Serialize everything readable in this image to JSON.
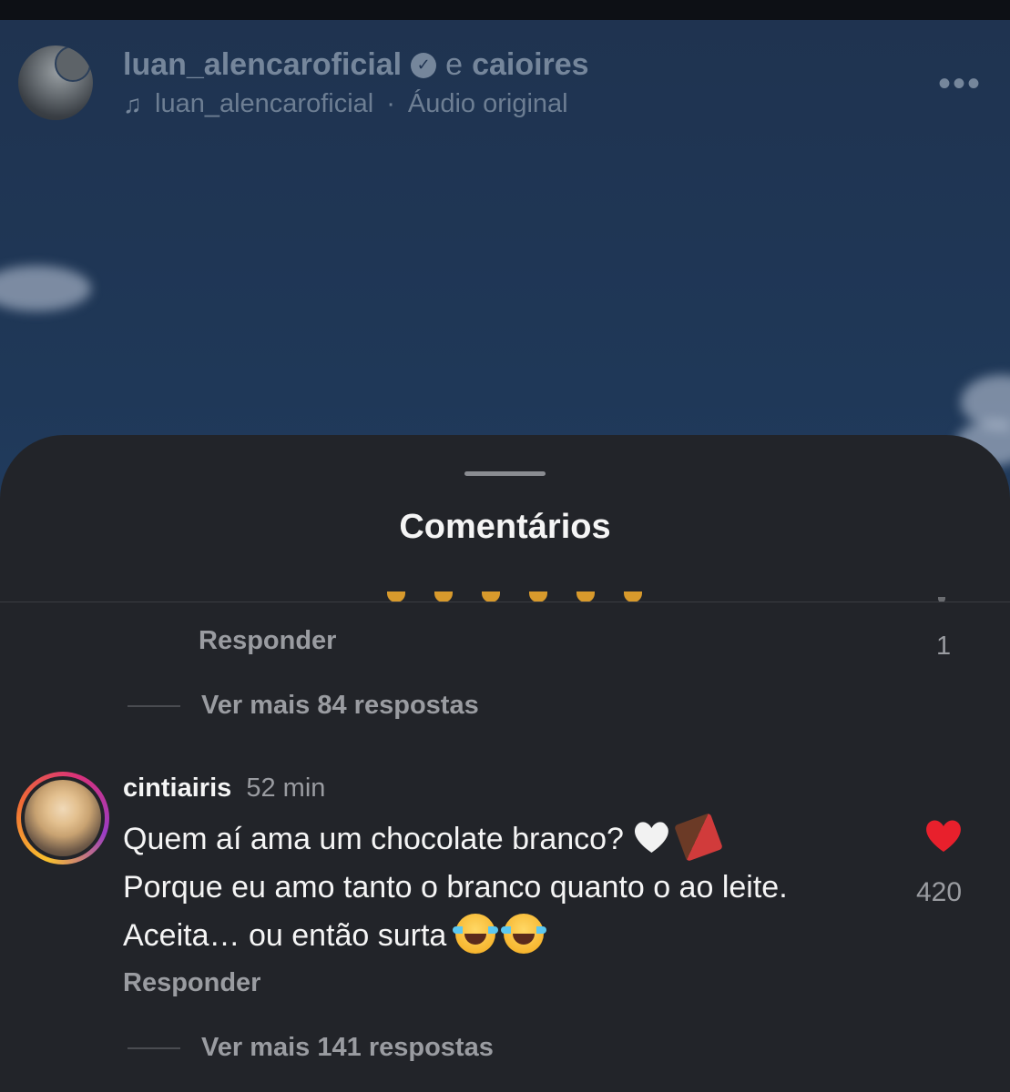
{
  "video_header": {
    "author": "luan_alencaroficial",
    "conjunction": "e",
    "collaborator": "caioires",
    "audio_author": "luan_alencaroficial",
    "audio_separator": "·",
    "audio_label": "Áudio original",
    "more_label": "•••"
  },
  "comments_sheet": {
    "title": "Comentários",
    "prev_thread": {
      "reply_label": "Responder",
      "like_count": "1",
      "more_replies": "Ver mais 84 respostas"
    },
    "comment": {
      "username": "cintiairis",
      "time": "52 min",
      "line1": "Quem aí ama um chocolate branco?",
      "line2": "Porque eu amo tanto o branco quanto o ao leite.",
      "line3": "Aceita… ou então surta",
      "emojis_line1": [
        "white-heart",
        "chocolate-bar"
      ],
      "emojis_line3": [
        "laughing-tears",
        "laughing-tears"
      ],
      "reply_label": "Responder",
      "like_count": "420",
      "liked": true,
      "more_replies": "Ver mais 141 respostas"
    }
  },
  "colors": {
    "sheet_bg": "#222429",
    "like_red": "#e8202c",
    "muted_text": "#9a9ca1"
  }
}
